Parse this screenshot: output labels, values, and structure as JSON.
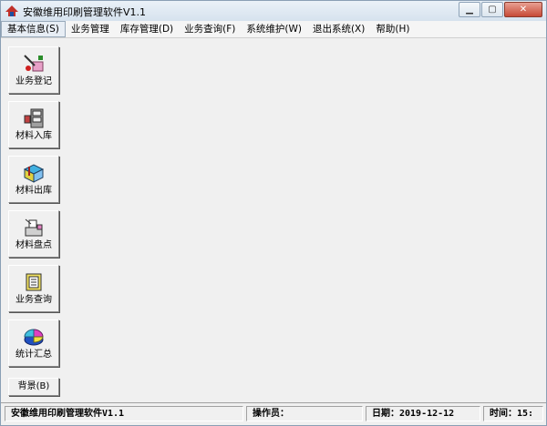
{
  "window": {
    "title": "安徽维用印刷管理软件V1.1"
  },
  "menu": [
    {
      "label": "基本信息(S)",
      "active": true
    },
    {
      "label": "业务管理"
    },
    {
      "label": "库存管理(D)"
    },
    {
      "label": "业务查询(F)"
    },
    {
      "label": "系统维护(W)"
    },
    {
      "label": "退出系统(X)"
    },
    {
      "label": "帮助(H)"
    }
  ],
  "toolbar": {
    "business_register": "业务登记",
    "material_in": "材料入库",
    "material_out": "材料出库",
    "material_inventory": "材料盘点",
    "business_query": "业务查询",
    "statistics_summary": "统计汇总",
    "background": "背景(B)"
  },
  "status": {
    "app_name": "安徽维用印刷管理软件V1.1",
    "operator_label": "操作员：",
    "date_label": "日期：",
    "date_value": "2019-12-12",
    "time_label": "时间：",
    "time_value": "15:"
  },
  "icons": [
    "app-icon",
    "minimize-icon",
    "maximize-icon",
    "close-icon",
    "register-icon",
    "material-in-icon",
    "material-out-icon",
    "inventory-icon",
    "query-icon",
    "pie-chart-icon"
  ]
}
